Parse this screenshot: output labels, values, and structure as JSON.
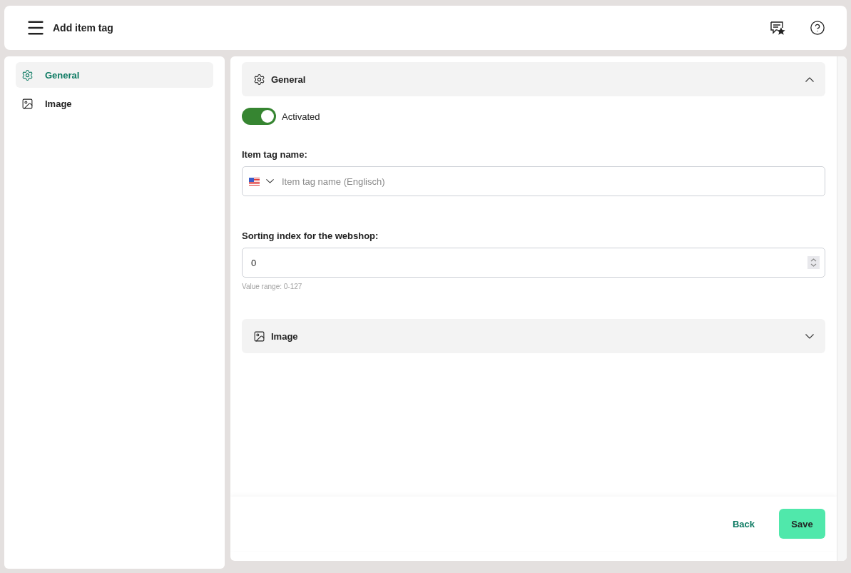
{
  "header": {
    "title": "Add item tag"
  },
  "sidebar": {
    "items": [
      {
        "label": "General",
        "selected": true
      },
      {
        "label": "Image",
        "selected": false
      }
    ]
  },
  "sections": [
    {
      "title": "General",
      "expanded": true
    },
    {
      "title": "Image",
      "expanded": false
    }
  ],
  "toggle": {
    "label": "Activated",
    "on": true
  },
  "name_field": {
    "label": "Item tag name:",
    "placeholder": "Item tag name (Englisch)"
  },
  "sort_field": {
    "label": "Sorting index for the webshop:",
    "value": "0",
    "hint": "Value range: 0-127"
  },
  "buttons": {
    "back": "Back",
    "save": "Save"
  }
}
